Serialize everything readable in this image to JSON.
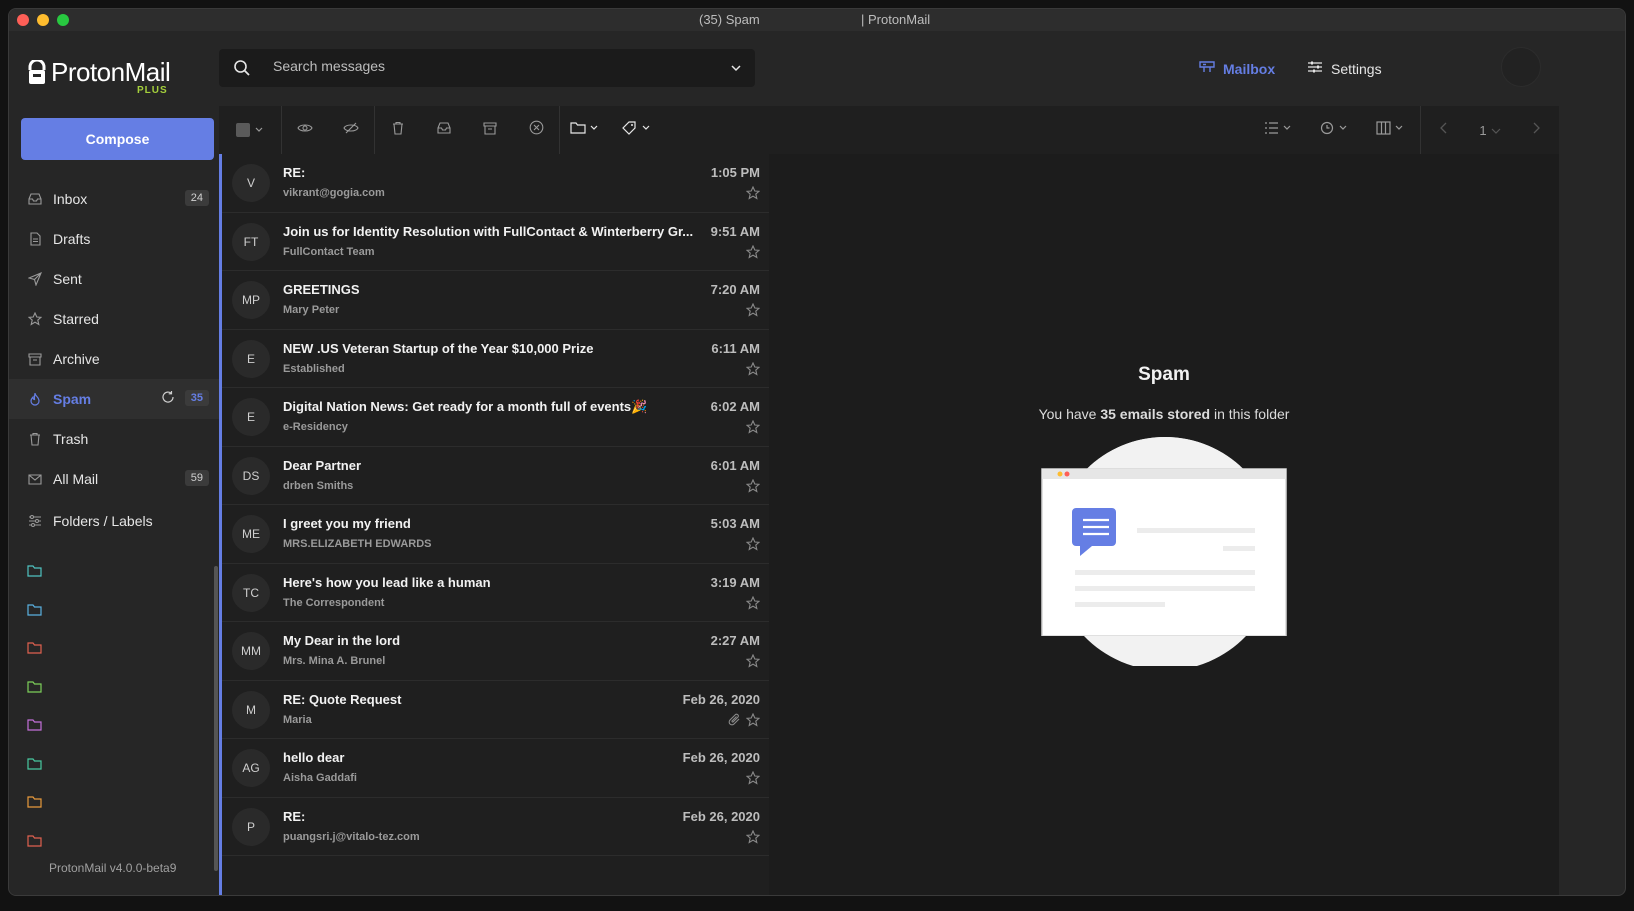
{
  "window": {
    "title_left": "(35) Spam",
    "title_right": "| ProtonMail"
  },
  "sidebar": {
    "logo_text": "ProtonMail",
    "plan_badge": "PLUS",
    "compose_label": "Compose",
    "items": [
      {
        "label": "Inbox",
        "icon": "inbox-icon",
        "count": "24"
      },
      {
        "label": "Drafts",
        "icon": "drafts-icon",
        "count": ""
      },
      {
        "label": "Sent",
        "icon": "sent-icon",
        "count": ""
      },
      {
        "label": "Starred",
        "icon": "star-icon",
        "count": ""
      },
      {
        "label": "Archive",
        "icon": "archive-icon",
        "count": ""
      },
      {
        "label": "Spam",
        "icon": "spam-icon",
        "count": "35",
        "active": true
      },
      {
        "label": "Trash",
        "icon": "trash-icon",
        "count": ""
      },
      {
        "label": "All Mail",
        "icon": "all-mail-icon",
        "count": "59"
      }
    ],
    "folders_label": "Folders / Labels",
    "folder_colors": [
      "#4fc3c1",
      "#5ab1e0",
      "#e0614f",
      "#7ccf5a",
      "#c46fd9",
      "#48c9a0",
      "#e89a3c",
      "#e0614f"
    ],
    "version": "ProtonMail v4.0.0-beta9"
  },
  "header": {
    "search_placeholder": "Search messages",
    "mailbox_label": "Mailbox",
    "settings_label": "Settings"
  },
  "toolbar": {
    "page_number": "1"
  },
  "messages": [
    {
      "initials": "V",
      "subject": "RE:",
      "sender": "vikrant@gogia.com",
      "time": "1:05 PM",
      "attachment": false
    },
    {
      "initials": "FT",
      "subject": "Join us for Identity Resolution with FullContact & Winterberry Gr...",
      "sender": "FullContact Team",
      "time": "9:51 AM",
      "attachment": false
    },
    {
      "initials": "MP",
      "subject": "GREETINGS",
      "sender": "Mary Peter",
      "time": "7:20 AM",
      "attachment": false
    },
    {
      "initials": "E",
      "subject": "NEW .US Veteran Startup of the Year $10,000 Prize",
      "sender": "Established",
      "time": "6:11 AM",
      "attachment": false
    },
    {
      "initials": "E",
      "subject": "Digital Nation News: Get ready for a month full of events🎉",
      "sender": "e-Residency",
      "time": "6:02 AM",
      "attachment": false
    },
    {
      "initials": "DS",
      "subject": "Dear Partner",
      "sender": "drben Smiths",
      "time": "6:01 AM",
      "attachment": false
    },
    {
      "initials": "ME",
      "subject": "I greet you my friend",
      "sender": "MRS.ELIZABETH EDWARDS",
      "time": "5:03 AM",
      "attachment": false
    },
    {
      "initials": "TC",
      "subject": "Here's how you lead like a human",
      "sender": "The Correspondent",
      "time": "3:19 AM",
      "attachment": false
    },
    {
      "initials": "MM",
      "subject": "My Dear in the lord",
      "sender": "Mrs. Mina A. Brunel",
      "time": "2:27 AM",
      "attachment": false
    },
    {
      "initials": "M",
      "subject": "RE: Quote Request",
      "sender": "Maria",
      "time": "Feb 26, 2020",
      "attachment": true
    },
    {
      "initials": "AG",
      "subject": "hello dear",
      "sender": "Aisha Gaddafi",
      "time": "Feb 26, 2020",
      "attachment": false
    },
    {
      "initials": "P",
      "subject": "RE:",
      "sender": "puangsri.j@vitalo-tez.com",
      "time": "Feb 26, 2020",
      "attachment": false
    }
  ],
  "panel": {
    "title": "Spam",
    "desc_prefix": "You have ",
    "desc_bold": "35 emails stored",
    "desc_suffix": " in this folder"
  },
  "colors": {
    "accent": "#657ee4",
    "plus": "#a4cf3c"
  }
}
